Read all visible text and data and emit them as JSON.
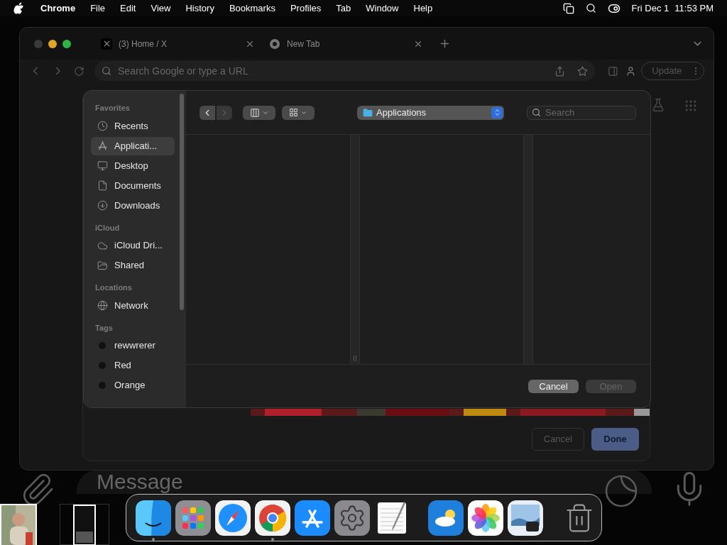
{
  "menu_bar": {
    "app": "Chrome",
    "menus": [
      "File",
      "Edit",
      "View",
      "History",
      "Bookmarks",
      "Profiles",
      "Tab",
      "Window",
      "Help"
    ],
    "date": "Fri Dec 1",
    "time": "11:53 PM"
  },
  "browser": {
    "tabs": [
      {
        "title": "(3) Home / X"
      },
      {
        "title": "New Tab"
      }
    ],
    "address_placeholder": "Search Google or type a URL",
    "update_button": "Update"
  },
  "message_field": {
    "placeholder": "Message"
  },
  "back_dialog": {
    "buttons": [
      {
        "label": "Cancel",
        "kind": "secondary"
      },
      {
        "label": "Done",
        "kind": "primary"
      }
    ]
  },
  "file_dialog": {
    "nav": [
      {
        "disabled": false
      },
      {
        "disabled": true
      }
    ],
    "location": "Applications",
    "search_placeholder": "Search",
    "sidebar": [
      {
        "heading": "Favorites",
        "items": [
          {
            "label": "Recents",
            "kind": "place",
            "selected": false
          },
          {
            "label": "Applicati...",
            "kind": "place",
            "selected": true
          },
          {
            "label": "Desktop",
            "kind": "place",
            "selected": false
          },
          {
            "label": "Documents",
            "kind": "place",
            "selected": false
          },
          {
            "label": "Downloads",
            "kind": "place",
            "selected": false
          }
        ]
      },
      {
        "heading": "iCloud",
        "items": [
          {
            "label": "iCloud Dri...",
            "kind": "place",
            "selected": false
          },
          {
            "label": "Shared",
            "kind": "place",
            "selected": false
          }
        ]
      },
      {
        "heading": "Locations",
        "items": [
          {
            "label": "Network",
            "kind": "place",
            "selected": false
          }
        ]
      },
      {
        "heading": "Tags",
        "items": [
          {
            "label": "rewwrerer",
            "kind": "tag",
            "selected": false
          },
          {
            "label": "Red",
            "kind": "tag",
            "selected": false
          },
          {
            "label": "Orange",
            "kind": "tag",
            "selected": false
          }
        ]
      }
    ],
    "buttons": [
      {
        "label": "Cancel",
        "disabled": false
      },
      {
        "label": "Open",
        "disabled": true
      }
    ]
  },
  "dock": {
    "groups": [
      [
        {
          "running": true
        },
        {
          "running": false
        },
        {
          "running": false
        },
        {
          "running": true
        },
        {
          "running": false
        },
        {
          "running": false
        },
        {
          "running": false
        }
      ],
      [
        {
          "running": false
        },
        {
          "running": false
        },
        {
          "running": false
        }
      ],
      [
        {
          "running": false
        }
      ]
    ]
  }
}
